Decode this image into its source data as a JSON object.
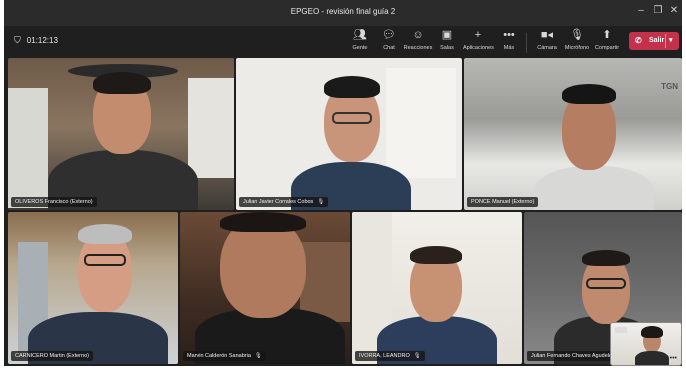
{
  "window": {
    "title": "EPGEO - revisión final guía 2"
  },
  "toolbar": {
    "timer": "01:12:13",
    "buttons": [
      {
        "label": "Gente",
        "icon": "people-icon"
      },
      {
        "label": "Chat",
        "icon": "chat-icon"
      },
      {
        "label": "Reacciones",
        "icon": "reactions-icon"
      },
      {
        "label": "Salas",
        "icon": "rooms-icon"
      },
      {
        "label": "Aplicaciones",
        "icon": "apps-icon"
      },
      {
        "label": "Más",
        "icon": "more-icon"
      },
      {
        "label": "Cámara",
        "icon": "camera-icon"
      },
      {
        "label": "Micrófono",
        "icon": "microphone-icon"
      },
      {
        "label": "Compartir",
        "icon": "share-icon"
      }
    ],
    "leave_label": "Salir"
  },
  "participants": [
    {
      "name": "OLIVEROS Francisco (Externo)",
      "muted": false
    },
    {
      "name": "Julian Javier Corrales Cobos",
      "muted": true
    },
    {
      "name": "PONCE Manuel (Externo)",
      "muted": false
    },
    {
      "name": "CARNICERO Martin (Externo)",
      "muted": false
    },
    {
      "name": "Marvin Calderón Sanabria",
      "muted": true
    },
    {
      "name": "IVORRA, LEANDRO",
      "muted": true
    },
    {
      "name": "Julian Fernando Chaves Agudelo (CENIT)",
      "muted": true
    }
  ],
  "tile_texts": {
    "logo_corner": "TGN"
  },
  "colors": {
    "leave_button": "#c4314b",
    "app_background": "#1f1f1f"
  }
}
